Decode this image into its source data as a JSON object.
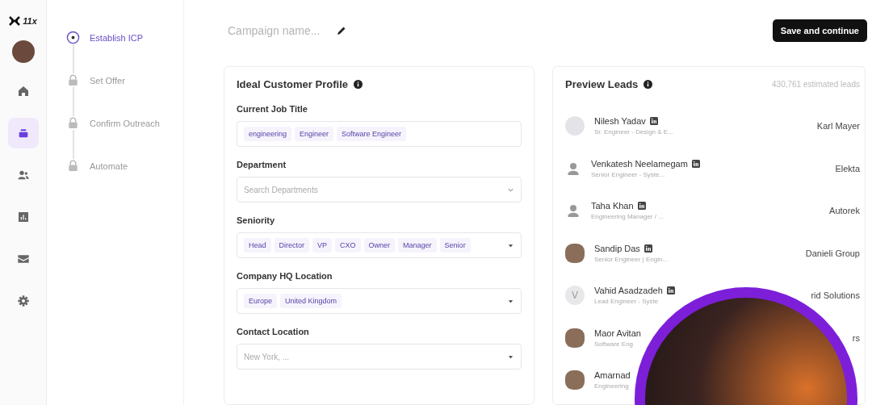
{
  "brand": {
    "name": "11x"
  },
  "nav": [
    {
      "kind": "home",
      "selected": false
    },
    {
      "kind": "campaigns",
      "selected": true
    },
    {
      "kind": "people",
      "selected": false
    },
    {
      "kind": "chart",
      "selected": false
    },
    {
      "kind": "mail",
      "selected": false
    },
    {
      "kind": "settings",
      "selected": false
    }
  ],
  "steps": [
    {
      "label": "Establish ICP",
      "kind": "current"
    },
    {
      "label": "Set Offer",
      "kind": "locked"
    },
    {
      "label": "Confirm Outreach",
      "kind": "locked"
    },
    {
      "label": "Automate",
      "kind": "locked"
    }
  ],
  "header": {
    "campaign_name": {
      "placeholder": "Campaign name..."
    },
    "save_button": "Save and continue"
  },
  "icp": {
    "title": "Ideal Customer Profile",
    "fields": [
      {
        "label": "Current Job Title",
        "tags": [
          "engineering",
          "Engineer",
          "Software Engineer"
        ],
        "kind": "plain"
      },
      {
        "label": "Department",
        "placeholder": "Search Departments",
        "kind": "chevron"
      },
      {
        "label": "Seniority",
        "tags": [
          "Head",
          "Director",
          "VP",
          "CXO",
          "Owner",
          "Manager",
          "Senior"
        ],
        "kind": "caret"
      },
      {
        "label": "Company HQ Location",
        "tags": [
          "Europe",
          "United Kingdom"
        ],
        "kind": "caret"
      },
      {
        "label": "Contact Location",
        "placeholder": "New York, ...",
        "kind": "caret"
      }
    ]
  },
  "leads": {
    "title": "Preview Leads",
    "estimate": "430,761 estimated leads",
    "rows": [
      {
        "name": "Nilesh Yadav",
        "title": "Sr. Engineer - Design & E...",
        "company": "Karl Mayer",
        "kind": "placeholder",
        "linkedin": true
      },
      {
        "name": "Venkatesh Neelamegam",
        "title": "Senior Engineer - Syste...",
        "company": "Elekta",
        "kind": "silhouette",
        "linkedin": true
      },
      {
        "name": "Taha Khan",
        "title": "Engineering Manager / ...",
        "company": "Autorek",
        "kind": "silhouette",
        "linkedin": true
      },
      {
        "name": "Sandip Das",
        "title": "Senior Engineer | Engin...",
        "company": "Danieli Group",
        "kind": "photo",
        "linkedin": true
      },
      {
        "name": "Vahid Asadzadeh",
        "initial": "V",
        "title": "Lead Engineer - Syste",
        "company": "rid Solutions",
        "kind": "initial",
        "linkedin": true
      },
      {
        "name": "Maor Avitan",
        "title": "Software Eng",
        "company": "rs",
        "kind": "photo",
        "linkedin": false
      },
      {
        "name": "Amarnad",
        "title": "Engineering",
        "kind": "photo",
        "linkedin": false
      }
    ]
  }
}
